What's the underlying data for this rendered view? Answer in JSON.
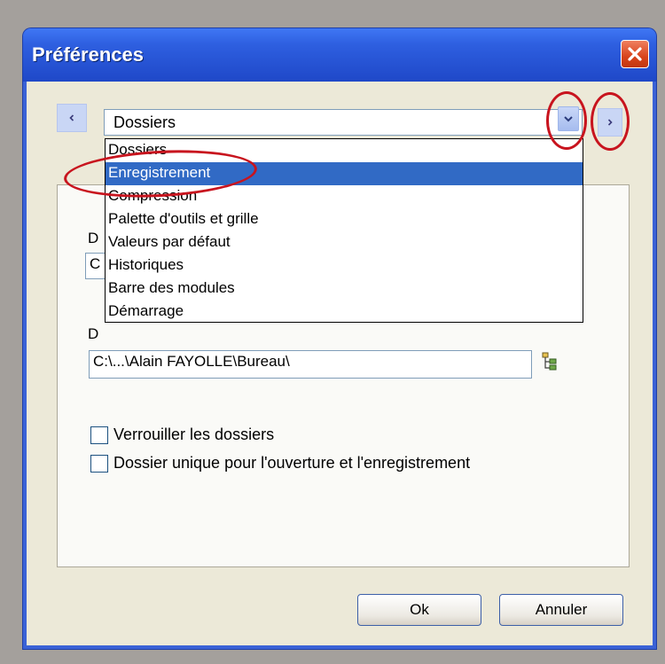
{
  "window": {
    "title": "Préférences"
  },
  "nav": {
    "prev_icon": "chevron-left-icon",
    "next_icon": "chevron-right-icon",
    "dropdown_icon": "chevron-down-icon"
  },
  "combo": {
    "value": "Dossiers"
  },
  "dropdown": {
    "items": [
      "Dossiers",
      "Enregistrement",
      "Compression",
      "Palette d'outils et grille",
      "Valeurs par défaut",
      "Historiques",
      "Barre des modules",
      "Démarrage"
    ],
    "selected_index": 1
  },
  "panel": {
    "field_1_value": "C",
    "field_2_value": "C:\\...\\Alain FAYOLLE\\Bureau\\",
    "label_1": "D",
    "label_2": "D",
    "checkboxes": [
      {
        "label": "Verrouiller les dossiers",
        "checked": false
      },
      {
        "label": "Dossier unique pour l'ouverture et l'enregistrement",
        "checked": false
      }
    ]
  },
  "buttons": {
    "ok": "Ok",
    "cancel": "Annuler"
  },
  "colors": {
    "titlebar": "#2e5fe0",
    "selection": "#316ac5",
    "annotation": "#c8141e",
    "close_button": "#d8441c"
  }
}
